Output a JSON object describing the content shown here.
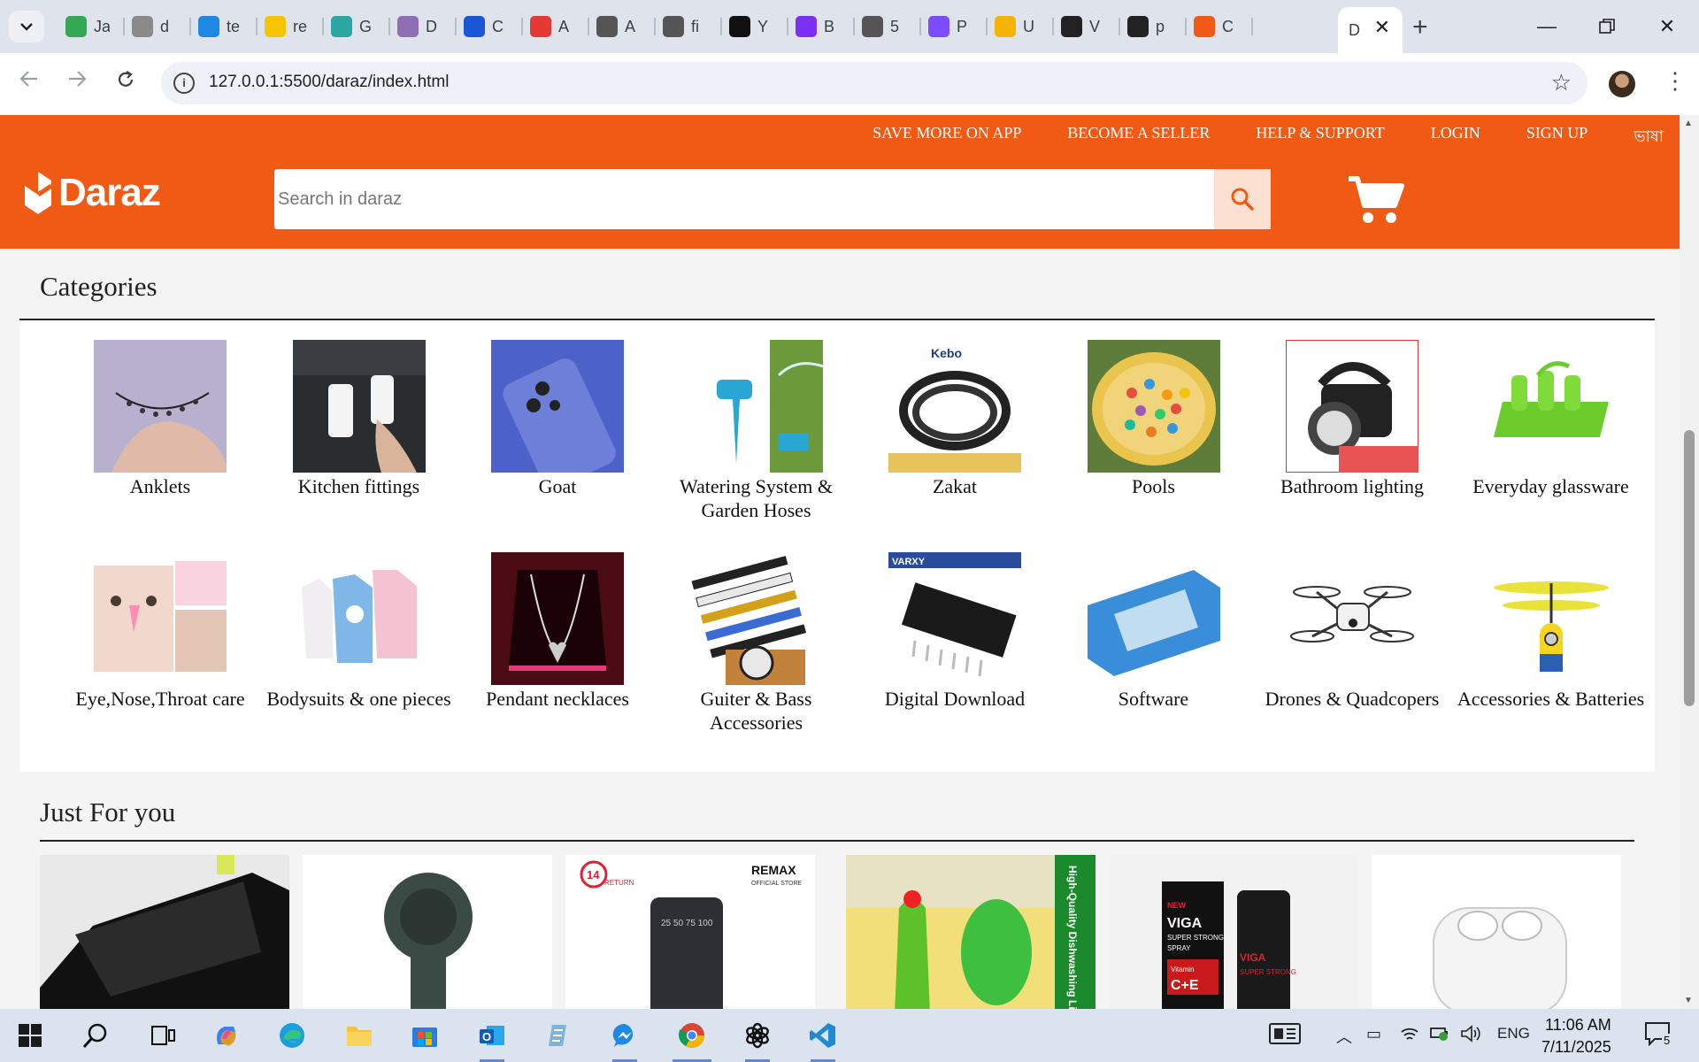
{
  "browser": {
    "tabs": [
      {
        "title": "Ja",
        "icon": "google-drive-icon",
        "color": "#34a853"
      },
      {
        "title": "d",
        "icon": "bird-icon",
        "color": "#8a8a8a"
      },
      {
        "title": "te",
        "icon": "h-logo-icon",
        "color": "#1e88e5"
      },
      {
        "title": "re",
        "icon": "smiley-icon",
        "color": "#f5c400"
      },
      {
        "title": "G",
        "icon": "document-icon",
        "color": "#2aa7a0"
      },
      {
        "title": "D",
        "icon": "avatar-icon",
        "color": "#8e6fb5"
      },
      {
        "title": "C",
        "icon": "flag-icon",
        "color": "#1a56d6"
      },
      {
        "title": "A",
        "icon": "camera-icon",
        "color": "#e53935"
      },
      {
        "title": "A",
        "icon": "globe-icon",
        "color": "#555555"
      },
      {
        "title": "fi",
        "icon": "globe-icon",
        "color": "#555555"
      },
      {
        "title": "Y",
        "icon": "github-icon",
        "color": "#111111"
      },
      {
        "title": "B",
        "icon": "bootstrap-icon",
        "color": "#7b2ff7"
      },
      {
        "title": "5",
        "icon": "globe-icon",
        "color": "#555555"
      },
      {
        "title": "P",
        "icon": "dots-icon",
        "color": "#7c4dff"
      },
      {
        "title": "U",
        "icon": "graduation-icon",
        "color": "#f4b400"
      },
      {
        "title": "V",
        "icon": "person-icon",
        "color": "#222222"
      },
      {
        "title": "p",
        "icon": "person-icon",
        "color": "#222222"
      },
      {
        "title": "C",
        "icon": "daraz-icon",
        "color": "#f15a14"
      }
    ],
    "active_tab": {
      "title": "D"
    },
    "url": "127.0.0.1:5500/daraz/index.html"
  },
  "site": {
    "colors": {
      "brand": "#f15a14"
    },
    "top_links": [
      "SAVE MORE ON APP",
      "BECOME A SELLER",
      "HELP & SUPPORT",
      "LOGIN",
      "SIGN UP",
      "ভাষা"
    ],
    "logo_text": "Daraz",
    "search_placeholder": "Search in daraz"
  },
  "categories": {
    "title": "Categories",
    "items": [
      {
        "label": "Anklets",
        "icon": "anklet-photo"
      },
      {
        "label": "Kitchen fittings",
        "icon": "hook-photo"
      },
      {
        "label": "Goat",
        "icon": "phone-case-photo"
      },
      {
        "label": "Watering System & Garden Hoses",
        "icon": "sprinkler-photo"
      },
      {
        "label": "Zakat",
        "icon": "belt-photo"
      },
      {
        "label": "Pools",
        "icon": "pool-photo"
      },
      {
        "label": "Bathroom lighting",
        "icon": "torch-photo"
      },
      {
        "label": "Everyday glassware",
        "icon": "glass-holder-photo"
      },
      {
        "label": "Eye,Nose,Throat care",
        "icon": "nose-clip-photo"
      },
      {
        "label": "Bodysuits & one pieces",
        "icon": "bodysuit-photo"
      },
      {
        "label": "Pendant necklaces",
        "icon": "necklace-photo"
      },
      {
        "label": "Guiter & Bass Accessories",
        "icon": "guitar-strap-photo"
      },
      {
        "label": "Digital Download",
        "icon": "chip-photo"
      },
      {
        "label": "Software",
        "icon": "screen-protector-photo"
      },
      {
        "label": "Drones & Quadcopers",
        "icon": "drone-photo"
      },
      {
        "label": "Accessories & Batteries",
        "icon": "minion-heli-photo"
      }
    ]
  },
  "just_for_you": {
    "title": "Just For you",
    "products": [
      {
        "name": "sunglasses",
        "image_text": []
      },
      {
        "name": "handheld-fan",
        "image_text": []
      },
      {
        "name": "power-bank",
        "image_text": [
          "14",
          "RETURN",
          "REMAX",
          "OFFICIAL STORE",
          "25 50 75 100"
        ]
      },
      {
        "name": "dishwashing-liquid",
        "image_text": [
          "High-Quality Dishwashing Liquid (Lemon Flavor)"
        ]
      },
      {
        "name": "viga-spray",
        "image_text": [
          "NEW",
          "VIGA",
          "SUPER STRONG",
          "SPRAY",
          "Vitamin",
          "C+E",
          "VIGA",
          "SUPER STRONG"
        ]
      },
      {
        "name": "earbuds",
        "image_text": []
      }
    ]
  },
  "taskbar": {
    "apps": [
      "start-icon",
      "search-icon",
      "task-view-icon",
      "copilot-icon",
      "edge-icon",
      "file-explorer-icon",
      "store-icon",
      "outlook-icon",
      "notepad-icon",
      "messenger-icon",
      "chrome-icon",
      "chatgpt-icon",
      "vscode-icon"
    ],
    "language": "ENG",
    "time": "11:06 AM",
    "date": "7/11/2025",
    "notifications": "5"
  }
}
